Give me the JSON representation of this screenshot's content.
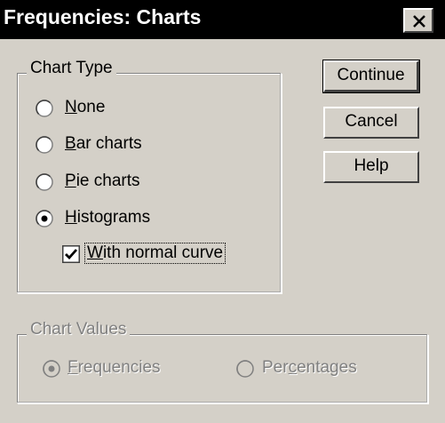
{
  "window": {
    "title": "Frequencies: Charts"
  },
  "chart_type": {
    "label": "Chart Type",
    "options": [
      {
        "pre": "",
        "key": "N",
        "post": "one",
        "selected": false
      },
      {
        "pre": "",
        "key": "B",
        "post": "ar charts",
        "selected": false
      },
      {
        "pre": "",
        "key": "P",
        "post": "ie charts",
        "selected": false
      },
      {
        "pre": "",
        "key": "H",
        "post": "istograms",
        "selected": true
      }
    ],
    "normal_curve": {
      "pre": "",
      "key": "W",
      "post": "ith normal curve",
      "checked": true
    }
  },
  "chart_values": {
    "label": "Chart Values",
    "enabled": false,
    "options": [
      {
        "pre": "",
        "key": "F",
        "post": "requencies",
        "selected": true
      },
      {
        "pre": "Per",
        "key": "c",
        "post": "entages",
        "selected": false
      }
    ]
  },
  "buttons": {
    "continue": "Continue",
    "cancel": "Cancel",
    "help": "Help"
  },
  "colors": {
    "face": "#d4d0c8",
    "title_bar": "#000000",
    "disabled_text": "#808080"
  }
}
